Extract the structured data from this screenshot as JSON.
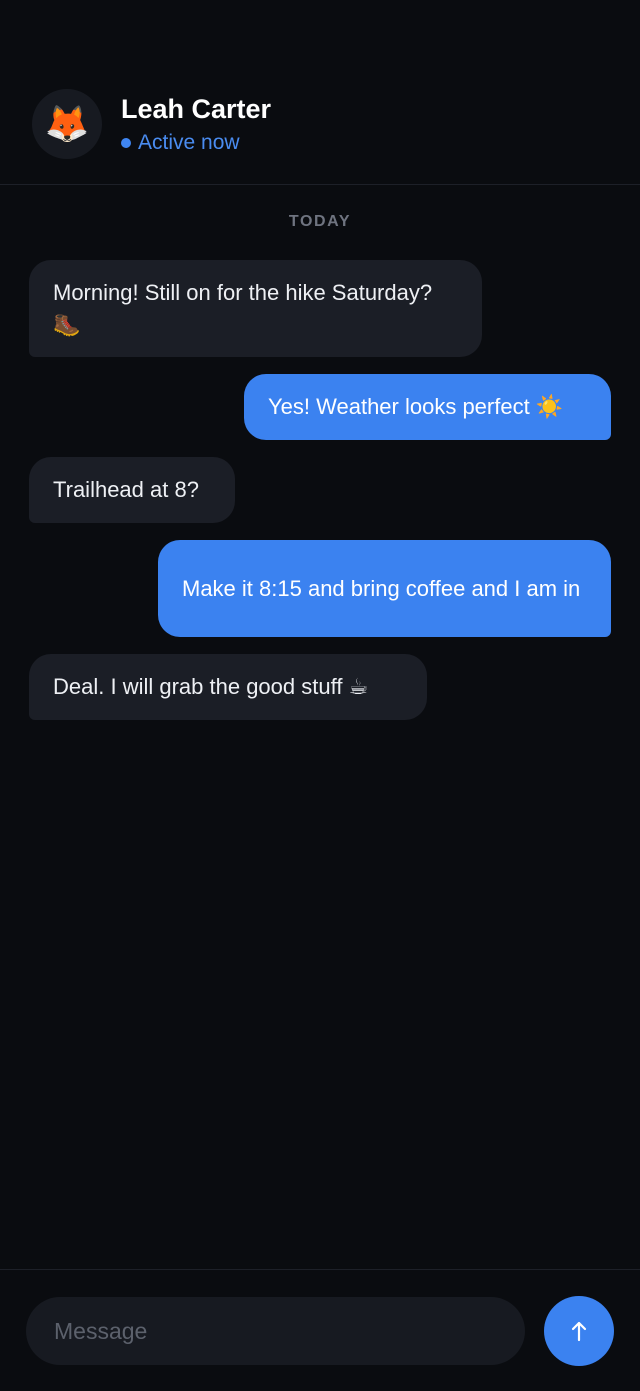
{
  "contact": {
    "avatar_emoji": "🦊",
    "name": "Leah Carter",
    "status": "Active now",
    "status_color": "#3f86f2"
  },
  "day_divider": "TODAY",
  "messages": [
    {
      "direction": "incoming",
      "text": "Morning! Still on for the hike Saturday? 🥾"
    },
    {
      "direction": "outgoing",
      "text": "Yes! Weather looks perfect ☀️"
    },
    {
      "direction": "incoming",
      "text": "Trailhead at 8?"
    },
    {
      "direction": "outgoing",
      "text": "Make it 8:15 and bring coffee and I am in"
    },
    {
      "direction": "incoming",
      "text": "Deal. I will grab the good stuff ☕"
    }
  ],
  "composer": {
    "placeholder": "Message",
    "send_icon": "arrow-up-icon"
  },
  "colors": {
    "background": "#0a0c10",
    "incoming_bubble": "#1b1e26",
    "outgoing_bubble": "#3b82f0",
    "accent": "#3b82f0"
  }
}
